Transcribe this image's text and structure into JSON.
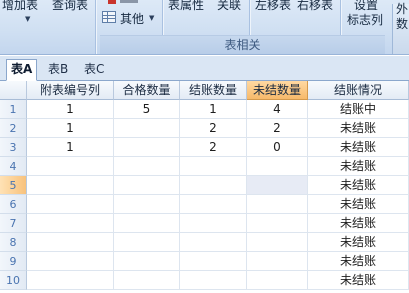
{
  "ribbon": {
    "add_table": "增加表",
    "query_table": "查询表",
    "other": "其他",
    "table_props": "表属性",
    "relation": "关联",
    "move_left": "左移表",
    "move_right": "右移表",
    "set_label_line1": "设置",
    "set_label_line2": "标志列",
    "group_caption": "表相关",
    "fragment_right_1": "外",
    "fragment_right_2": "数"
  },
  "tabs": [
    {
      "label": "表A",
      "active": true
    },
    {
      "label": "表B",
      "active": false
    },
    {
      "label": "表C",
      "active": false
    }
  ],
  "grid": {
    "columns": [
      "附表编号列",
      "合格数量",
      "结账数量",
      "未结数量",
      "结账情况"
    ],
    "selected_column": 3,
    "active_cell": {
      "row": 5,
      "col": 3
    },
    "row_numbers": [
      "1",
      "2",
      "3",
      "4",
      "5",
      "6",
      "7",
      "8",
      "9",
      "10"
    ],
    "rows": [
      [
        "1",
        "5",
        "1",
        "4",
        "结账中"
      ],
      [
        "1",
        "",
        "2",
        "2",
        "未结账"
      ],
      [
        "1",
        "",
        "2",
        "0",
        "未结账"
      ],
      [
        "",
        "",
        "",
        "",
        "未结账"
      ],
      [
        "",
        "",
        "",
        "",
        "未结账"
      ],
      [
        "",
        "",
        "",
        "",
        "未结账"
      ],
      [
        "",
        "",
        "",
        "",
        "未结账"
      ],
      [
        "",
        "",
        "",
        "",
        "未结账"
      ],
      [
        "",
        "",
        "",
        "",
        "未结账"
      ],
      [
        "",
        "",
        "",
        "",
        "未结账"
      ]
    ]
  }
}
